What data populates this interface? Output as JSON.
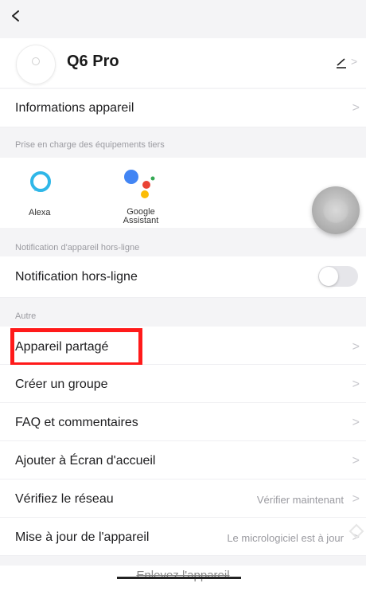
{
  "device": {
    "name": "Q6 Pro"
  },
  "rows": {
    "info": "Informations appareil",
    "offline_notification": "Notification hors-ligne",
    "shared_device": "Appareil partagé",
    "create_group": "Créer un groupe",
    "faq": "FAQ et commentaires",
    "add_home": "Ajouter à Écran d'accueil",
    "network": "Vérifiez le réseau",
    "network_value": "Vérifier maintenant",
    "update": "Mise à jour de l'appareil",
    "update_value": "Le micrologiciel est à jour"
  },
  "sections": {
    "third_party": "Prise en charge des équipements tiers",
    "offline": "Notification d'appareil hors-ligne",
    "other": "Autre"
  },
  "third_party": {
    "alexa": "Alexa",
    "google_assistant": "Google Assistant"
  },
  "toggle": {
    "offline_notification_on": false
  },
  "remove_device": "Enlevez l'appareil",
  "icons": {
    "back": "back-arrow-icon",
    "edit": "pencil-icon",
    "chevron": "chevron-right-icon",
    "alexa": "alexa-icon",
    "google_assistant": "google-assistant-icon"
  },
  "colors": {
    "highlight": "#ff1a1a",
    "background": "#f4f4f6"
  }
}
